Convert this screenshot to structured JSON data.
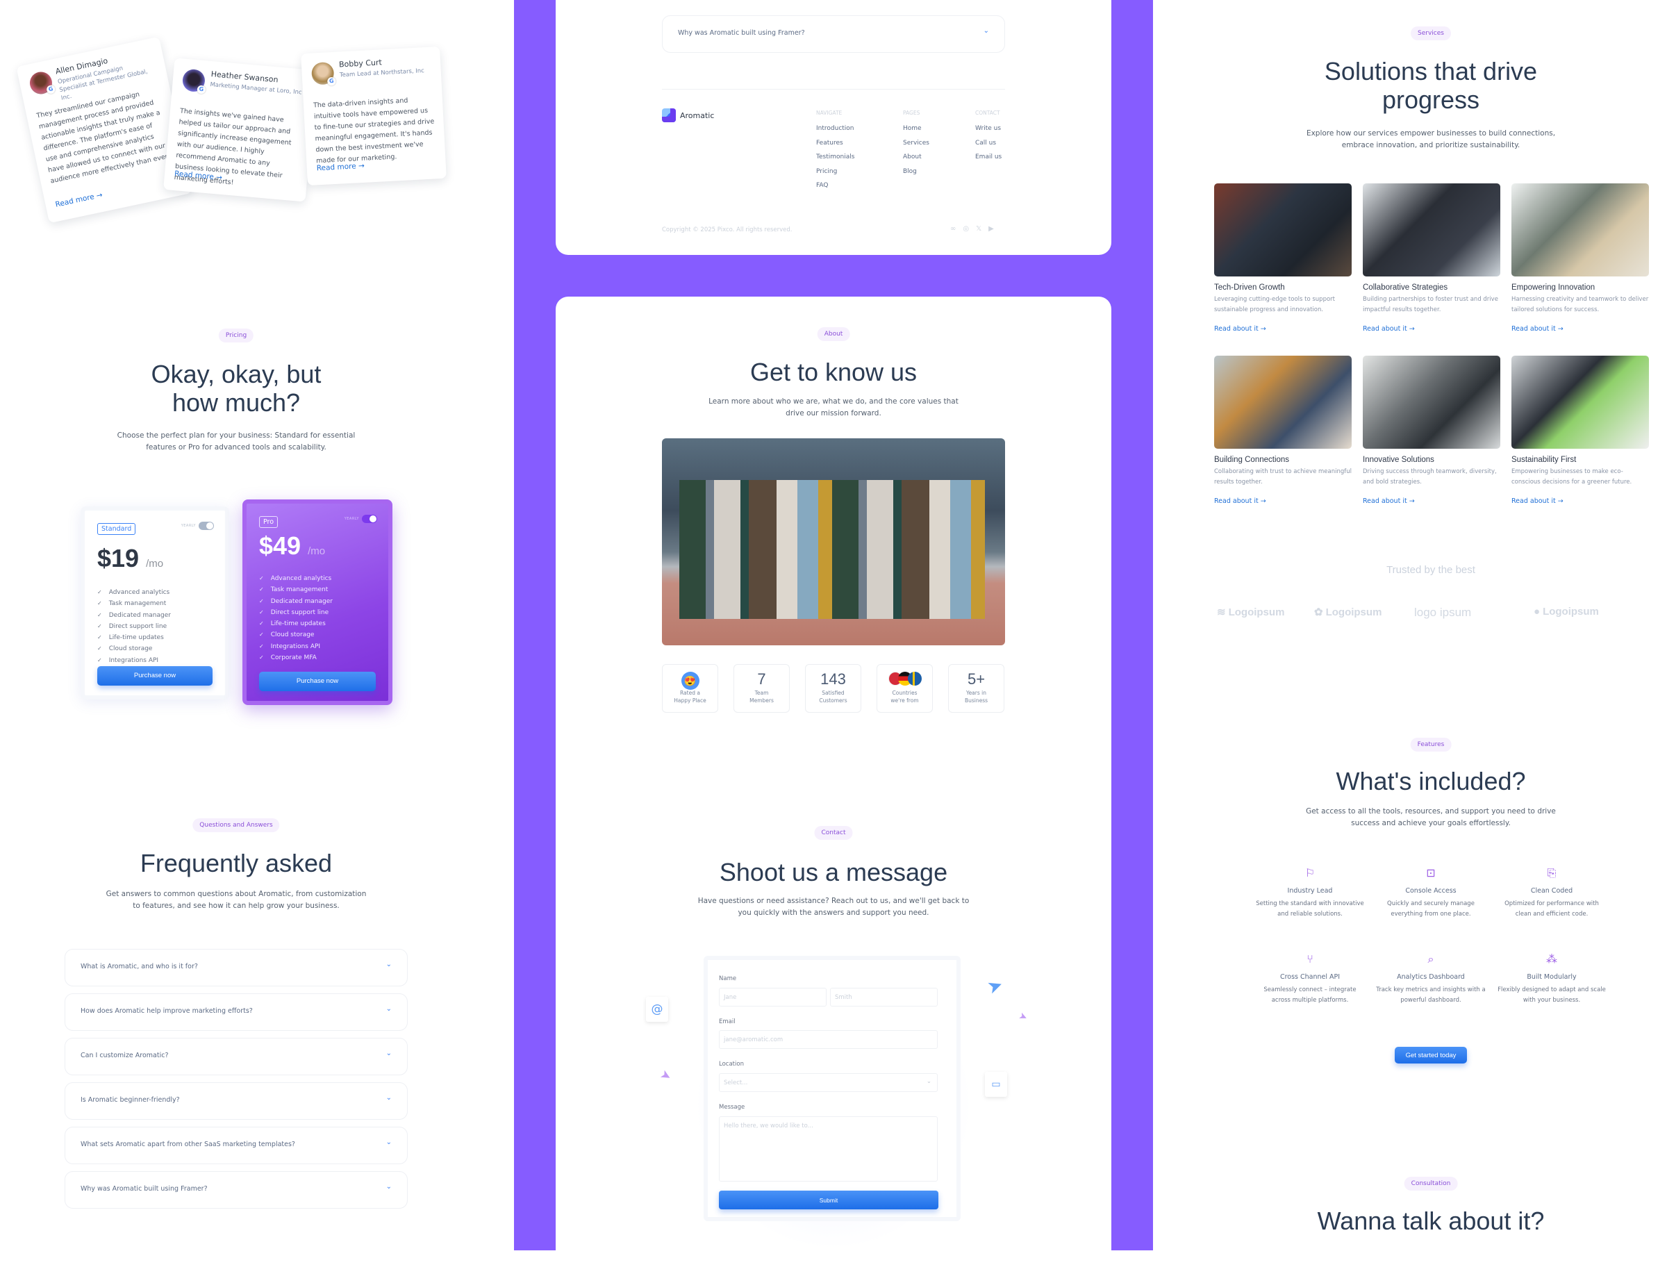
{
  "testimonials": [
    {
      "name": "Allen Dimagio",
      "role": "Operational Campaign Specialist at Termester Global, Inc.",
      "text": "They streamlined our campaign management process and provided actionable insights that truly make a difference. The platform's ease of use and comprehensive analytics have allowed us to connect with our audience more effectively than ever.",
      "link": "Read more →"
    },
    {
      "name": "Heather Swanson",
      "role": "Marketing Manager at Loro, Inc",
      "text": "The insights we've gained have helped us tailor our approach and significantly increase engagement with our audience. I highly recommend Aromatic to any business looking to elevate their marketing efforts!",
      "link": "Read more →"
    },
    {
      "name": "Bobby Curt",
      "role": "Team Lead at Northstars, Inc",
      "text": "The data-driven insights and intuitive tools have empowered us to fine-tune our strategies and drive meaningful engagement. It's hands down the best investment we've made for our marketing.",
      "link": "Read more →"
    }
  ],
  "pricing": {
    "pill": "Pricing",
    "title_l1": "Okay, okay, but",
    "title_l2": "how much?",
    "subtitle_l1": "Choose the perfect plan for your business: Standard for essential",
    "subtitle_l2": "features or Pro for advanced tools and scalability.",
    "toggle_label": "YEARLY",
    "plans": [
      {
        "tag": "Standard",
        "price": "$19",
        "per": "/mo",
        "features": [
          "Advanced analytics",
          "Task management",
          "Dedicated manager",
          "Direct support line",
          "Life-time updates",
          "Cloud storage",
          "Integrations API"
        ],
        "button": "Purchase now"
      },
      {
        "tag": "Pro",
        "price": "$49",
        "per": "/mo",
        "features": [
          "Advanced analytics",
          "Task management",
          "Dedicated manager",
          "Direct support line",
          "Life-time updates",
          "Cloud storage",
          "Integrations API",
          "Corporate MFA"
        ],
        "button": "Purchase now"
      }
    ]
  },
  "faq": {
    "pill": "Questions and Answers",
    "title": "Frequently asked",
    "subtitle_l1": "Get answers to common questions about Aromatic, from customization",
    "subtitle_l2": "to features, and see how it can help grow your business.",
    "questions": [
      "What is Aromatic, and who is it for?",
      "How does Aromatic help improve marketing efforts?",
      "Can I customize Aromatic?",
      "Is Aromatic beginner-friendly?",
      "What sets Aromatic apart from other SaaS marketing templates?",
      "Why was Aromatic built using Framer?"
    ]
  },
  "footer": {
    "last_question": "Why was Aromatic built using Framer?",
    "brand": "Aromatic",
    "columns": [
      {
        "heading": "NAVIGATE",
        "links": [
          "Introduction",
          "Features",
          "Testimonials",
          "Pricing",
          "FAQ"
        ]
      },
      {
        "heading": "PAGES",
        "links": [
          "Home",
          "Services",
          "About",
          "Blog"
        ]
      },
      {
        "heading": "CONTACT",
        "links": [
          "Write us",
          "Call us",
          "Email us"
        ]
      }
    ],
    "copyright": "Copyright © 2025 Pixco. All rights reserved.",
    "social": [
      "meta-icon",
      "instagram-icon",
      "x-icon",
      "youtube-icon"
    ]
  },
  "about": {
    "pill": "About",
    "title": "Get to know us",
    "subtitle_l1": "Learn more about who we are, what we do, and the core values that",
    "subtitle_l2": "drive our mission forward.",
    "stats": [
      {
        "value": "",
        "label_l1": "Rated a",
        "label_l2": "Happy Place"
      },
      {
        "value": "7",
        "label_l1": "Team",
        "label_l2": "Members"
      },
      {
        "value": "143",
        "label_l1": "Satisfied",
        "label_l2": "Customers"
      },
      {
        "value": "",
        "label_l1": "Countries",
        "label_l2": "we're from"
      },
      {
        "value": "5+",
        "label_l1": "Years in",
        "label_l2": "Business"
      }
    ]
  },
  "contact": {
    "pill": "Contact",
    "title": "Shoot us a message",
    "subtitle_l1": "Have questions or need assistance? Reach out to us, and we'll get back to",
    "subtitle_l2": "you quickly with the answers and support you need.",
    "name_label": "Name",
    "first_placeholder": "Jane",
    "last_placeholder": "Smith",
    "email_label": "Email",
    "email_placeholder": "jane@aromatic.com",
    "location_label": "Location",
    "location_placeholder": "Select...",
    "message_label": "Message",
    "message_placeholder": "Hello there, we would like to...",
    "submit": "Submit"
  },
  "services": {
    "pill": "Services",
    "title_l1": "Solutions that drive",
    "title_l2": "progress",
    "subtitle_l1": "Explore how our services empower businesses to build connections,",
    "subtitle_l2": "embrace innovation, and prioritize sustainability.",
    "items": [
      {
        "title": "Tech-Driven Growth",
        "desc": "Leveraging cutting-edge tools to support sustainable progress and innovation.",
        "link": "Read about it →"
      },
      {
        "title": "Collaborative Strategies",
        "desc": "Building partnerships to foster trust and drive impactful results together.",
        "link": "Read about it →"
      },
      {
        "title": "Empowering Innovation",
        "desc": "Harnessing creativity and teamwork to deliver tailored solutions for success.",
        "link": "Read about it →"
      },
      {
        "title": "Building Connections",
        "desc": "Collaborating with trust to achieve meaningful results together.",
        "link": "Read about it →"
      },
      {
        "title": "Innovative Solutions",
        "desc": "Driving success through teamwork, diversity, and bold strategies.",
        "link": "Read about it →"
      },
      {
        "title": "Sustainability First",
        "desc": "Empowering businesses to make eco-conscious decisions for a greener future.",
        "link": "Read about it →"
      }
    ]
  },
  "trusted": {
    "title": "Trusted by the best",
    "logos": [
      "Logoipsum",
      "Logoipsum",
      "logo ipsum",
      "Logoipsum"
    ]
  },
  "features": {
    "pill": "Features",
    "title": "What's included?",
    "subtitle_l1": "Get access to all the tools, resources, and support you need to drive",
    "subtitle_l2": "success and achieve your goals effortlessly.",
    "items": [
      {
        "icon": "flag-icon",
        "title": "Industry Lead",
        "desc": "Setting the standard with innovative and reliable solutions."
      },
      {
        "icon": "terminal-icon",
        "title": "Console Access",
        "desc": "Quickly and securely manage everything from one place."
      },
      {
        "icon": "code-file-icon",
        "title": "Clean Coded",
        "desc": "Optimized for performance with clean and efficient code."
      },
      {
        "icon": "git-pull-icon",
        "title": "Cross Channel API",
        "desc": "Seamlessly connect – integrate across multiple platforms."
      },
      {
        "icon": "search-code-icon",
        "title": "Analytics Dashboard",
        "desc": "Track key metrics and insights with a powerful dashboard."
      },
      {
        "icon": "blocks-icon",
        "title": "Built Modularly",
        "desc": "Flexibly designed to adapt and scale with your business."
      }
    ],
    "cta": "Get started today"
  },
  "consultation": {
    "pill": "Consultation",
    "title": "Wanna talk about it?"
  },
  "colors": {
    "accent": "#865cff",
    "link": "#1f6fd6",
    "button": "#2a7cf0",
    "pill_text": "#8a4fd8",
    "heading": "#2b3b52"
  }
}
